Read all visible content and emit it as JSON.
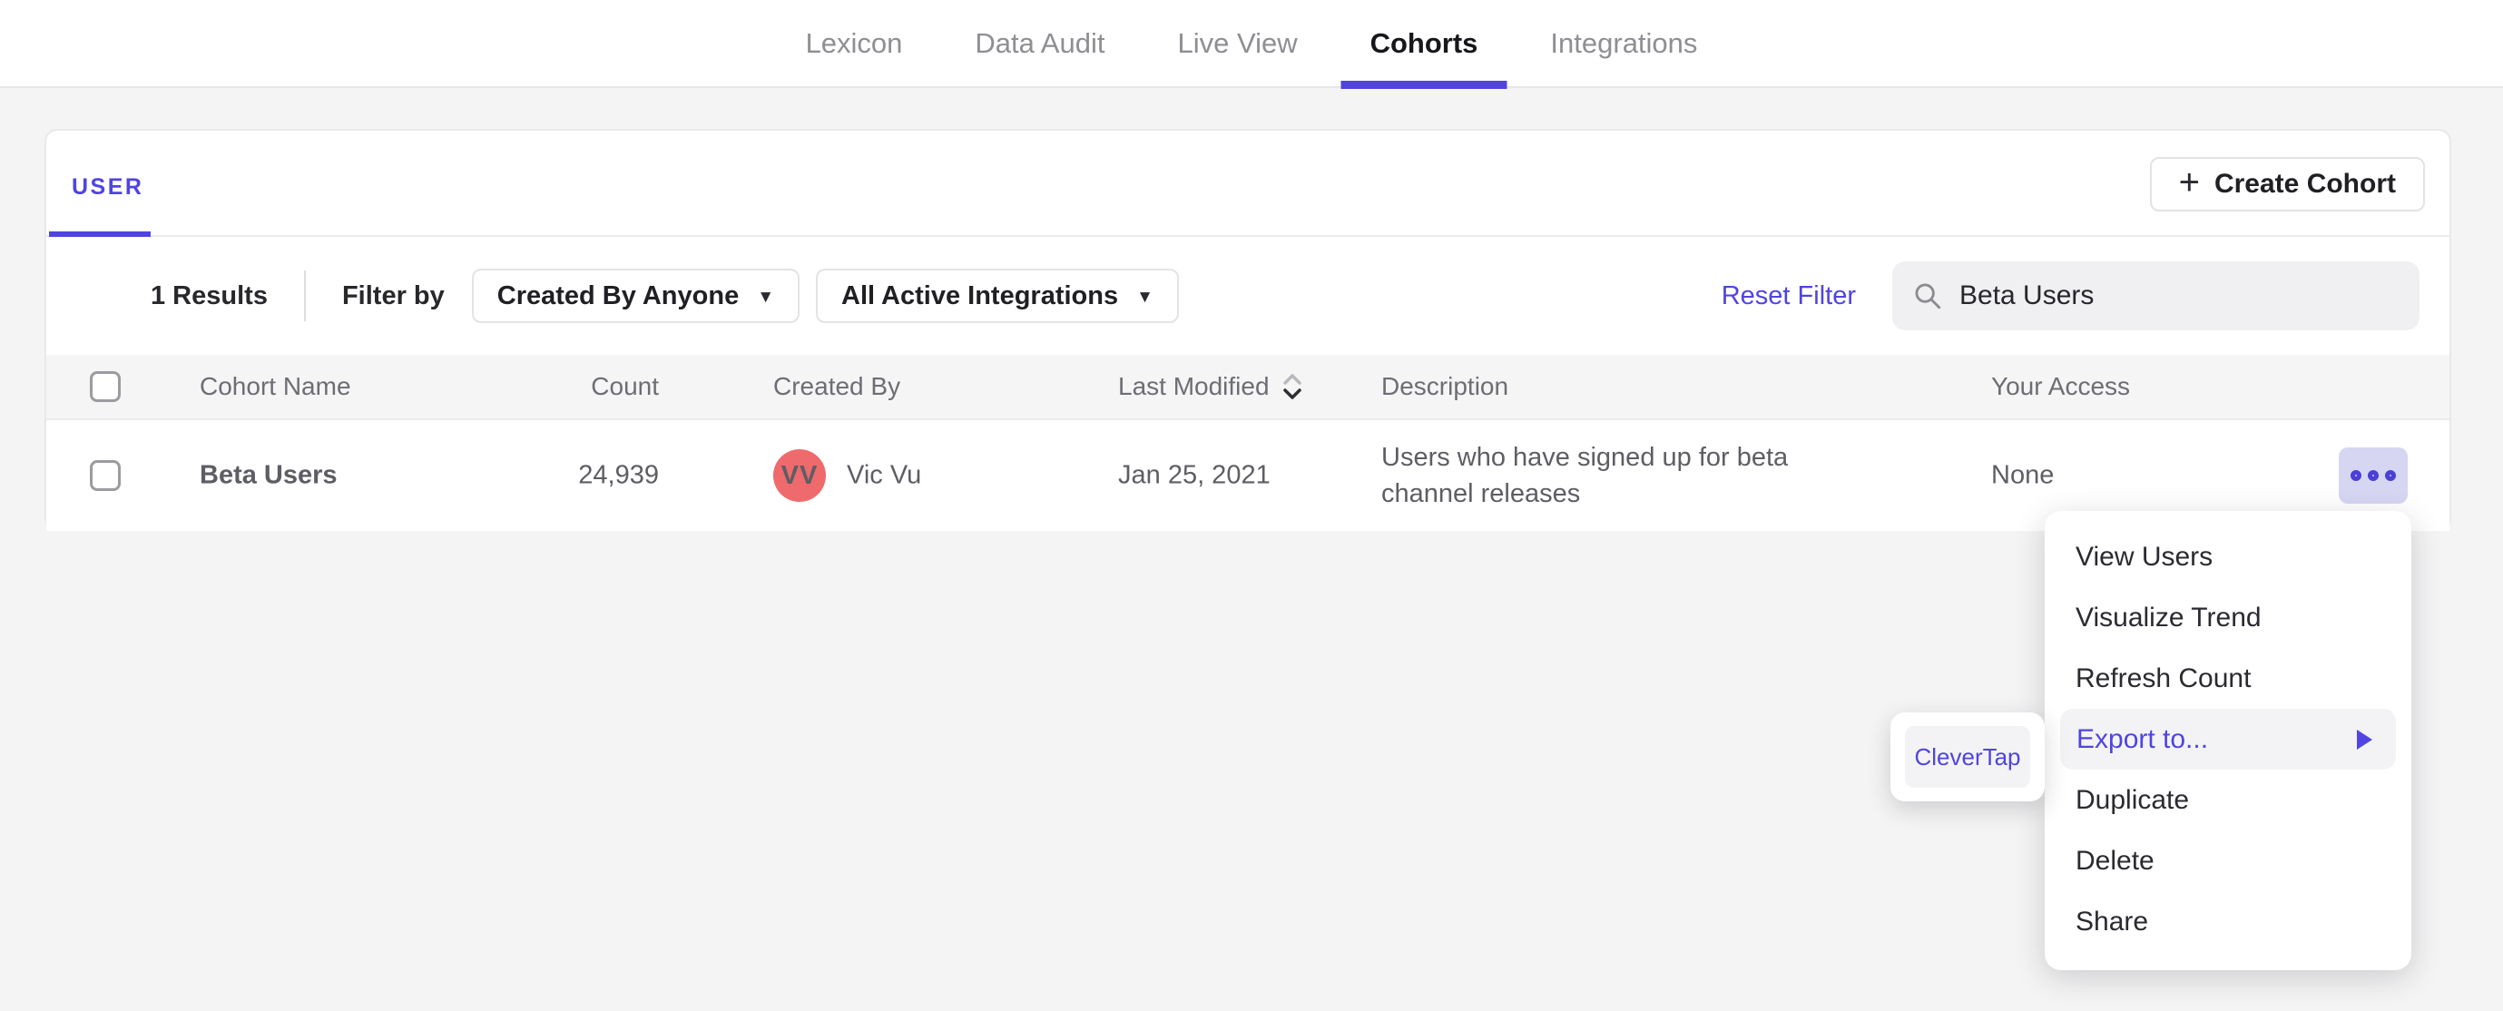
{
  "colors": {
    "accent": "#4f44e0",
    "avatar": "#ee6a6d",
    "cohort_link": "#39337a",
    "dots_button_bg": "#d6d6f3",
    "page_bg": "#f4f4f5"
  },
  "nav": {
    "items": [
      "Lexicon",
      "Data Audit",
      "Live View",
      "Cohorts",
      "Integrations"
    ],
    "active": "Cohorts"
  },
  "tabs": {
    "user": "USER"
  },
  "toolbar": {
    "create_label": "Create Cohort",
    "plus_glyph": "+"
  },
  "filters": {
    "results": "1 Results",
    "filter_by": "Filter by",
    "created_by_value": "Created By Anyone",
    "integrations_value": "All Active Integrations",
    "reset": "Reset Filter",
    "caret_glyph": "▼"
  },
  "search": {
    "value": "Beta Users"
  },
  "table": {
    "headers": {
      "name": "Cohort Name",
      "count": "Count",
      "created_by": "Created By",
      "last_modified": "Last Modified",
      "description": "Description",
      "access": "Your Access"
    },
    "row": {
      "name": "Beta Users",
      "count": "24,939",
      "creator_initials": "VV",
      "creator_name": "Vic Vu",
      "last_modified": "Jan 25, 2021",
      "description": "Users who have signed up for beta channel releases",
      "access": "None"
    }
  },
  "menu": {
    "items": [
      "View Users",
      "Visualize Trend",
      "Refresh Count",
      "Export to...",
      "Duplicate",
      "Delete",
      "Share"
    ],
    "highlighted": "Export to..."
  },
  "submenu": {
    "label": "CleverTap"
  }
}
